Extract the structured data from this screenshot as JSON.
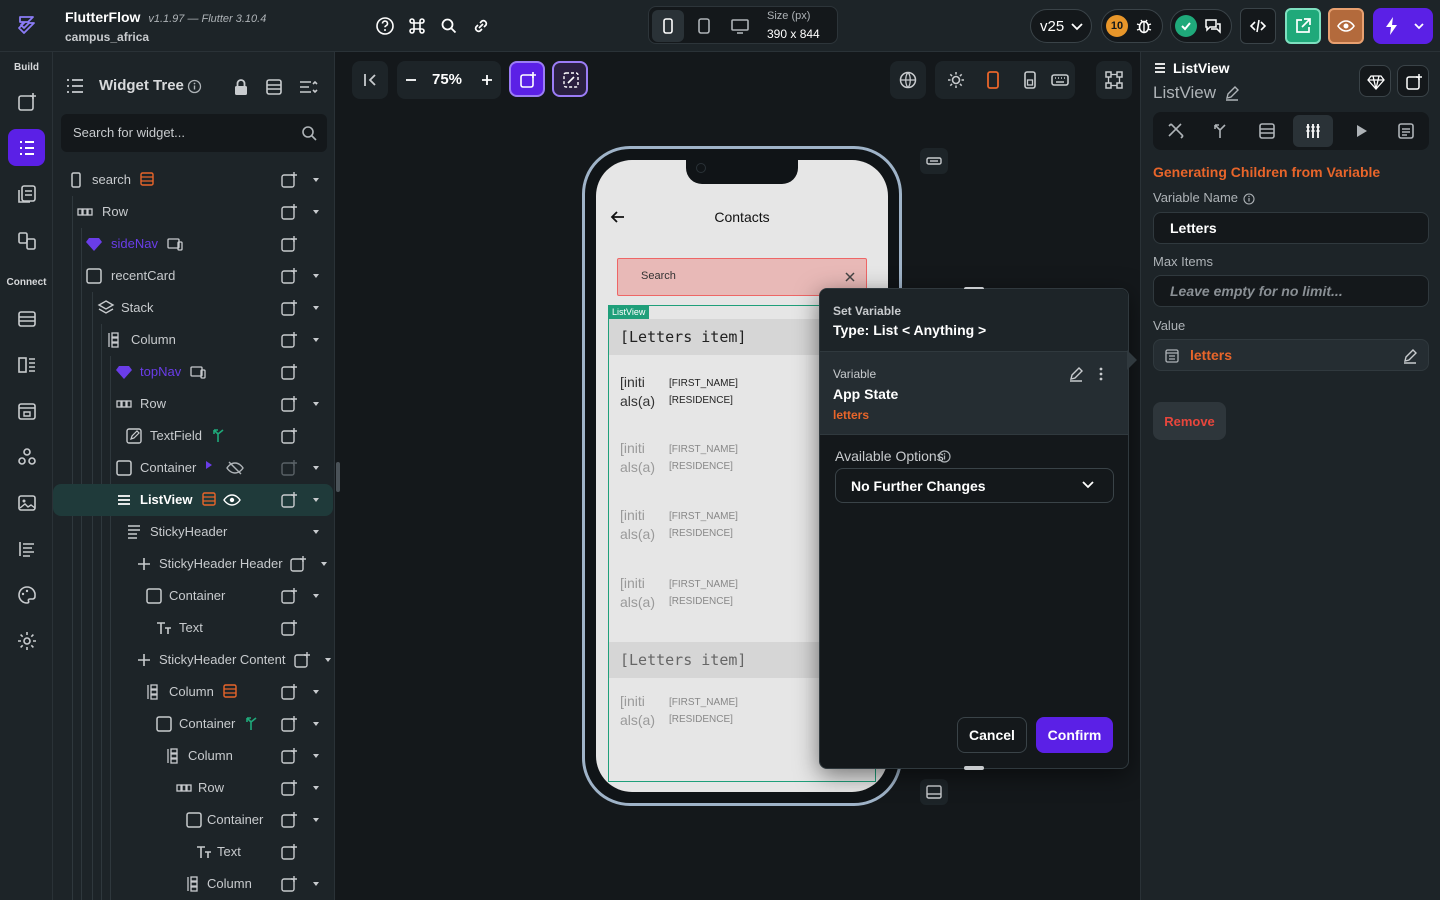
{
  "app": {
    "name": "FlutterFlow",
    "version": "v1.1.97 — Flutter 3.10.4",
    "project": "campus_africa"
  },
  "topbar": {
    "size_label": "Size (px)",
    "size_value": "390 x 844",
    "branch": "v25",
    "notification_count": "10"
  },
  "rail": {
    "build_label": "Build",
    "connect_label": "Connect"
  },
  "tree": {
    "title": "Widget Tree",
    "search_placeholder": "Search for widget...",
    "rows": [
      {
        "label": "search"
      },
      {
        "label": "Row"
      },
      {
        "label": "sideNav"
      },
      {
        "label": "recentCard"
      },
      {
        "label": "Stack"
      },
      {
        "label": "Column"
      },
      {
        "label": "topNav"
      },
      {
        "label": "Row"
      },
      {
        "label": "TextField"
      },
      {
        "label": "Container"
      },
      {
        "label": "ListView"
      },
      {
        "label": "StickyHeader"
      },
      {
        "label": "StickyHeader Header"
      },
      {
        "label": "Container"
      },
      {
        "label": "Text"
      },
      {
        "label": "StickyHeader Content"
      },
      {
        "label": "Column"
      },
      {
        "label": "Container"
      },
      {
        "label": "Column"
      },
      {
        "label": "Row"
      },
      {
        "label": "Container"
      },
      {
        "label": "Text"
      },
      {
        "label": "Column"
      }
    ]
  },
  "canvas": {
    "zoom": "75%"
  },
  "phone": {
    "title": "Contacts",
    "search_placeholder": "Search",
    "listview_tag": "ListView",
    "header_label": "[Letters item]",
    "header_label_2": "[Letters item]",
    "items": [
      {
        "initials_1": "[initi",
        "initials_2": "als(a)",
        "name": "[FIRST_NAME]",
        "residence": "[RESIDENCE]"
      },
      {
        "initials_1": "[initi",
        "initials_2": "als(a)",
        "name": "[FIRST_NAME]",
        "residence": "[RESIDENCE]"
      },
      {
        "initials_1": "[initi",
        "initials_2": "als(a)",
        "name": "[FIRST_NAME]",
        "residence": "[RESIDENCE]"
      },
      {
        "initials_1": "[initi",
        "initials_2": "als(a)",
        "name": "[FIRST_NAME]",
        "residence": "[RESIDENCE]"
      },
      {
        "initials_1": "[initi",
        "initials_2": "als(a)",
        "name": "[FIRST_NAME]",
        "residence": "[RESIDENCE]"
      }
    ]
  },
  "dialog": {
    "title": "Set Variable",
    "type": "Type: List < Anything >",
    "variable_label": "Variable",
    "variable_source": "App State",
    "variable_name": "letters",
    "options_label": "Available Options",
    "option_selected": "No Further Changes",
    "cancel": "Cancel",
    "confirm": "Confirm"
  },
  "props": {
    "widget_type": "ListView",
    "widget_name": "ListView",
    "section_title": "Generating Children from Variable",
    "variable_name_label": "Variable Name",
    "variable_name_value": "Letters",
    "max_items_label": "Max Items",
    "max_items_placeholder": "Leave empty for no limit...",
    "value_label": "Value",
    "value": "letters",
    "remove": "Remove"
  },
  "colors": {
    "accent_purple": "#5b20e6",
    "accent_orange": "#e8652a",
    "selected_teal": "#1f3a3a",
    "remove_red": "#e8463c"
  }
}
